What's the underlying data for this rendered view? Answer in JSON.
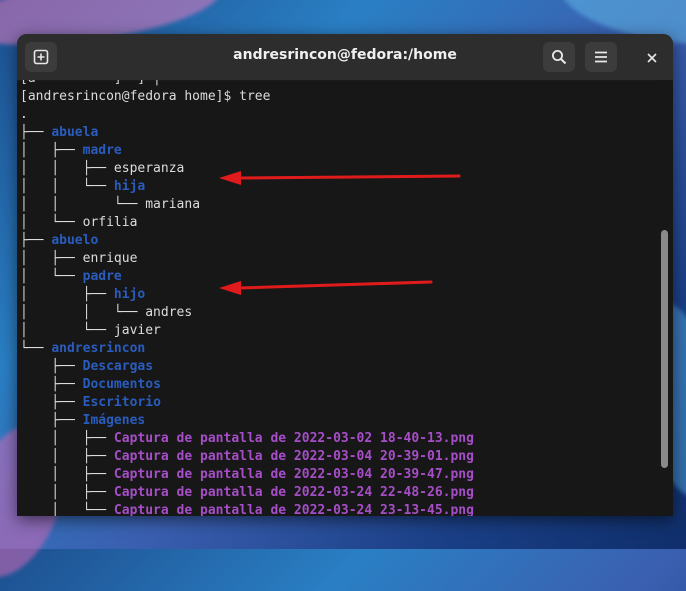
{
  "window": {
    "title": "andresrincon@fedora:/home"
  },
  "terminal": {
    "cut_line": "[a          ]  ] |",
    "prompt": "[andresrincon@fedora home]$ tree",
    "lines": [
      {
        "prefix": ".",
        "name": "",
        "kind": "plain"
      },
      {
        "prefix": "├── ",
        "name": "abuela",
        "kind": "dir"
      },
      {
        "prefix": "│   ├── ",
        "name": "madre",
        "kind": "dir"
      },
      {
        "prefix": "│   │   ├── ",
        "name": "esperanza",
        "kind": "plain"
      },
      {
        "prefix": "│   │   └── ",
        "name": "hija",
        "kind": "dir"
      },
      {
        "prefix": "│   │       └── ",
        "name": "mariana",
        "kind": "plain"
      },
      {
        "prefix": "│   └── ",
        "name": "orfilia",
        "kind": "plain"
      },
      {
        "prefix": "├── ",
        "name": "abuelo",
        "kind": "dir"
      },
      {
        "prefix": "│   ├── ",
        "name": "enrique",
        "kind": "plain"
      },
      {
        "prefix": "│   └── ",
        "name": "padre",
        "kind": "dir"
      },
      {
        "prefix": "│       ├── ",
        "name": "hijo",
        "kind": "dir"
      },
      {
        "prefix": "│       │   └── ",
        "name": "andres",
        "kind": "plain"
      },
      {
        "prefix": "│       └── ",
        "name": "javier",
        "kind": "plain"
      },
      {
        "prefix": "└── ",
        "name": "andresrincon",
        "kind": "dir"
      },
      {
        "prefix": "    ├── ",
        "name": "Descargas",
        "kind": "dir"
      },
      {
        "prefix": "    ├── ",
        "name": "Documentos",
        "kind": "dir"
      },
      {
        "prefix": "    ├── ",
        "name": "Escritorio",
        "kind": "dir"
      },
      {
        "prefix": "    ├── ",
        "name": "Imágenes",
        "kind": "dir"
      },
      {
        "prefix": "    │   ├── ",
        "name": "Captura de pantalla de 2022-03-02 18-40-13.png",
        "kind": "img"
      },
      {
        "prefix": "    │   ├── ",
        "name": "Captura de pantalla de 2022-03-04 20-39-01.png",
        "kind": "img"
      },
      {
        "prefix": "    │   ├── ",
        "name": "Captura de pantalla de 2022-03-04 20-39-47.png",
        "kind": "img"
      },
      {
        "prefix": "    │   ├── ",
        "name": "Captura de pantalla de 2022-03-24 22-48-26.png",
        "kind": "img"
      },
      {
        "prefix": "    │   └── ",
        "name": "Captura de pantalla de 2022-03-24 23-13-45.png",
        "kind": "img"
      }
    ]
  },
  "icons": {
    "new_tab": "new-tab-icon",
    "search": "search-icon",
    "menu": "hamburger-menu-icon",
    "close": "close-icon"
  },
  "colors": {
    "directory": "#2a5cbd",
    "image_file": "#a64ec7",
    "annotation_arrow": "#e01b1b"
  }
}
